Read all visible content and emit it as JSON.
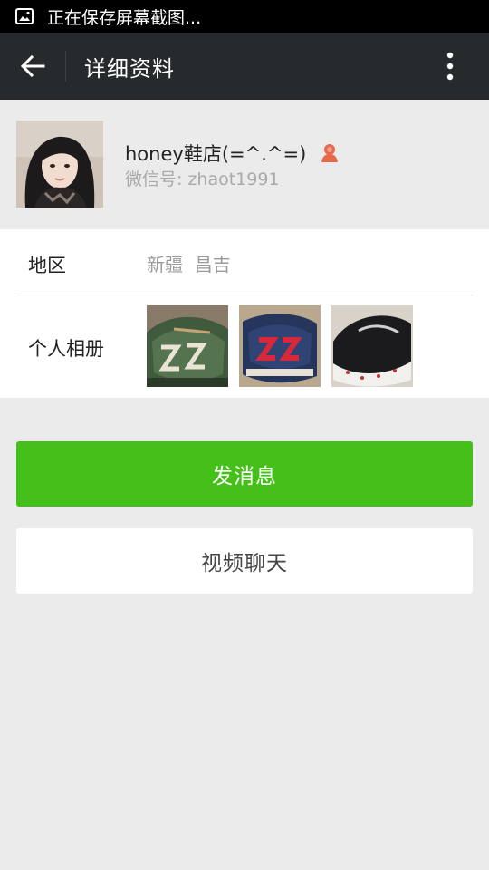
{
  "status_bar": {
    "text": "正在保存屏幕截图..."
  },
  "app_bar": {
    "title": "详细资料"
  },
  "profile": {
    "nickname": "honey鞋店(=^.^=)",
    "wechat_id": "微信号: zhaot1991"
  },
  "info": {
    "region_label": "地区",
    "region_value": "新疆  昌吉",
    "album_label": "个人相册"
  },
  "actions": {
    "send_message": "发消息",
    "video_chat": "视频聊天"
  },
  "colors": {
    "primary_green": "#45c01a",
    "app_bar": "#272a2d",
    "background": "#ebebeb"
  }
}
